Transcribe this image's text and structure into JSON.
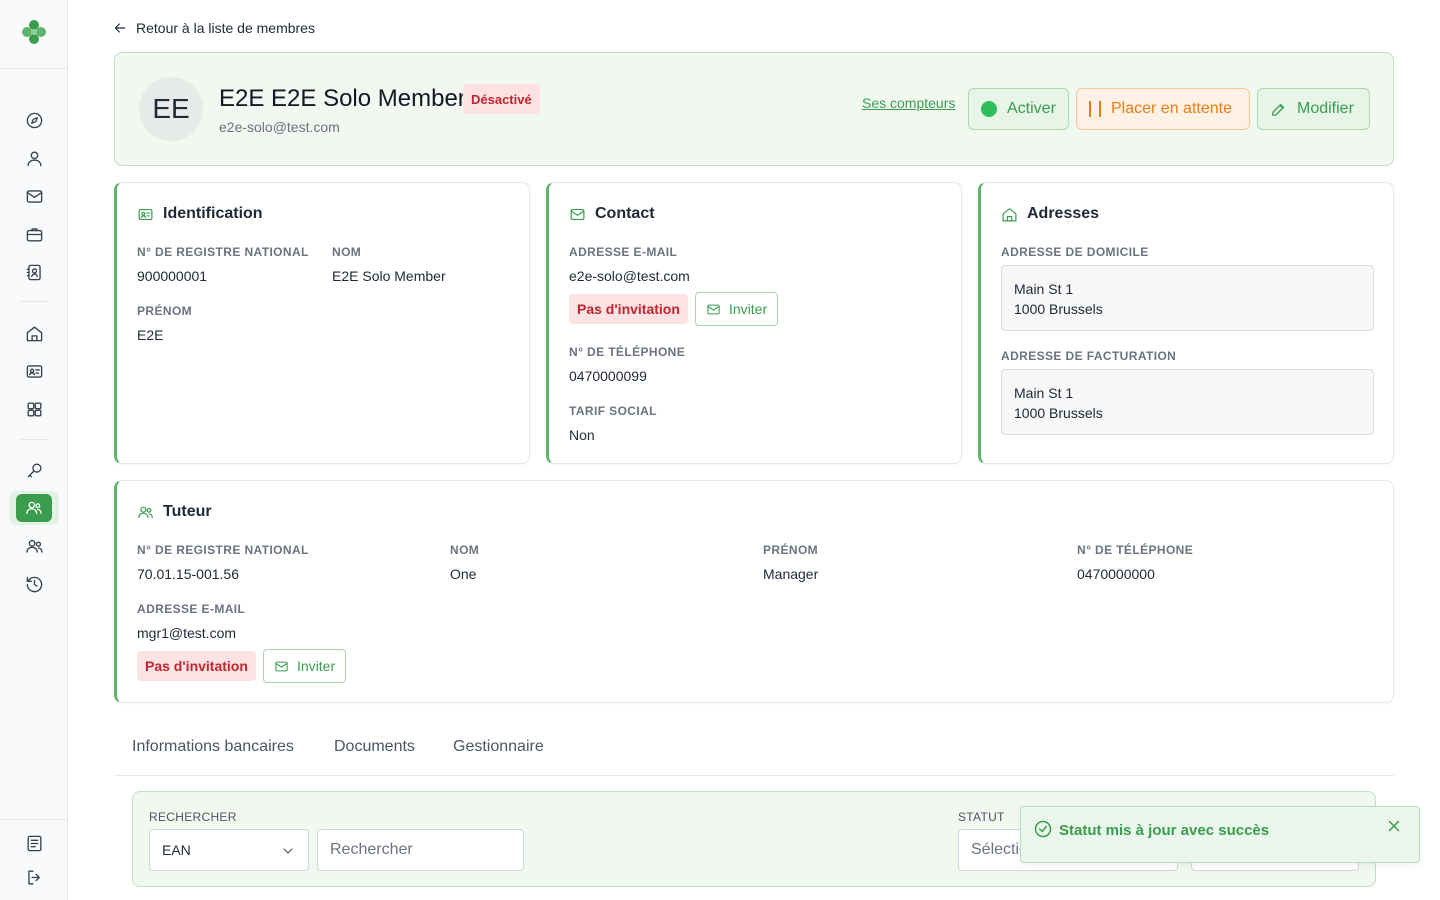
{
  "back_link": "Retour à la liste de membres",
  "member": {
    "initials": "EE",
    "name": "E2E E2E Solo Member",
    "status_badge": "Désactivé",
    "email": "e2e-solo@test.com"
  },
  "header_actions": {
    "counters_link": "Ses compteurs",
    "activate": "Activer",
    "hold": "Placer en attente",
    "edit": "Modifier"
  },
  "identification": {
    "title": "Identification",
    "nrn_label": "N° DE REGISTRE NATIONAL",
    "nrn_value": "900000001",
    "lastname_label": "NOM",
    "lastname_value": "E2E Solo Member",
    "firstname_label": "PRÉNOM",
    "firstname_value": "E2E"
  },
  "contact": {
    "title": "Contact",
    "email_label": "ADRESSE E-MAIL",
    "email_value": "e2e-solo@test.com",
    "invite_status": "Pas d'invitation",
    "invite_button": "Inviter",
    "phone_label": "N° DE TÉLÉPHONE",
    "phone_value": "0470000099",
    "social_label": "TARIF SOCIAL",
    "social_value": "Non"
  },
  "addresses": {
    "title": "Adresses",
    "home_label": "ADRESSE DE DOMICILE",
    "home_line1": "Main St 1",
    "home_line2": "1000 Brussels",
    "billing_label": "ADRESSE DE FACTURATION",
    "billing_line1": "Main St 1",
    "billing_line2": "1000 Brussels"
  },
  "guardian": {
    "title": "Tuteur",
    "nrn_label": "N° DE REGISTRE NATIONAL",
    "nrn_value": "70.01.15-001.56",
    "lastname_label": "NOM",
    "lastname_value": "One",
    "firstname_label": "PRÉNOM",
    "firstname_value": "Manager",
    "phone_label": "N° DE TÉLÉPHONE",
    "phone_value": "0470000000",
    "email_label": "ADRESSE E-MAIL",
    "email_value": "mgr1@test.com",
    "invite_status": "Pas d'invitation",
    "invite_button": "Inviter"
  },
  "tabs": [
    "Informations bancaires",
    "Documents",
    "Gestionnaire"
  ],
  "filters": {
    "search_label": "RECHERCHER",
    "search_type": "EAN",
    "search_placeholder": "Rechercher",
    "status_label": "STATUT",
    "status_value": "Sélectio"
  },
  "toast": {
    "message": "Statut mis à jour avec succès"
  },
  "colors": {
    "brand_green": "#3a9d4e",
    "danger": "#c0262d",
    "warning": "#e87e18"
  }
}
